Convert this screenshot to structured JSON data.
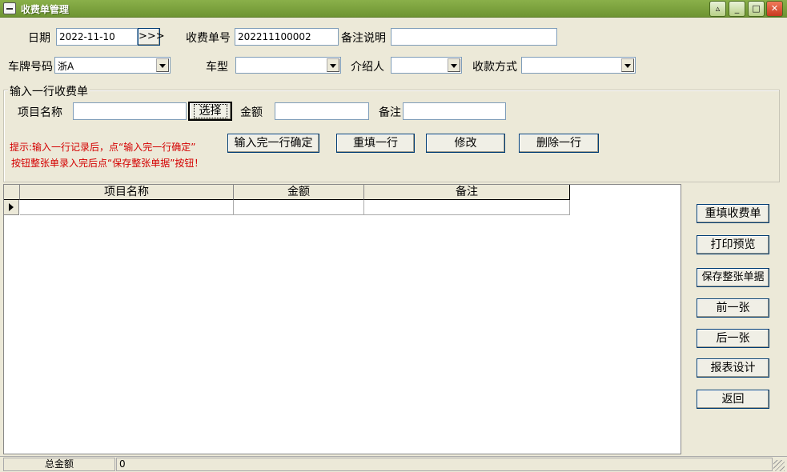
{
  "window": {
    "title": "收费单管理"
  },
  "header": {
    "date_label": "日期",
    "date_value": "2022-11-10",
    "date_btn": ">>>",
    "receipt_no_label": "收费单号",
    "receipt_no_value": "202211100002",
    "remark_label": "备注说明",
    "remark_value": "",
    "plate_label": "车牌号码",
    "plate_value": "浙A",
    "car_type_label": "车型",
    "car_type_value": "",
    "referrer_label": "介绍人",
    "referrer_value": "",
    "payment_label": "收款方式",
    "payment_value": ""
  },
  "entry": {
    "group_title": "输入一行收费单",
    "item_label": "项目名称",
    "item_value": "",
    "select_btn": "选择",
    "amount_label": "金额",
    "amount_value": "",
    "note_label": "备注",
    "note_value": "",
    "hint_line1": "提示:输入一行记录后，点“输入完一行确定”",
    "hint_line2": "按钮整张单录入完后点“保存整张单据”按钮！",
    "confirm_btn": "输入完一行确定",
    "refill_row_btn": "重填一行",
    "modify_btn": "修改",
    "delete_row_btn": "删除一行"
  },
  "grid": {
    "columns": [
      "项目名称",
      "金额",
      "备注"
    ],
    "rows": [
      [
        "",
        "",
        ""
      ]
    ]
  },
  "side_buttons": {
    "refill_receipt": "重填收费单",
    "print_preview": "打印预览",
    "save_receipt": "保存整张单据",
    "prev": "前一张",
    "next": "后一张",
    "report_design": "报表设计",
    "back": "返回"
  },
  "status": {
    "total_label": "总金额",
    "total_value": "0"
  },
  "colors": {
    "titlebar": "#7aa23c",
    "hint": "#d40000",
    "face": "#ece9d8"
  }
}
